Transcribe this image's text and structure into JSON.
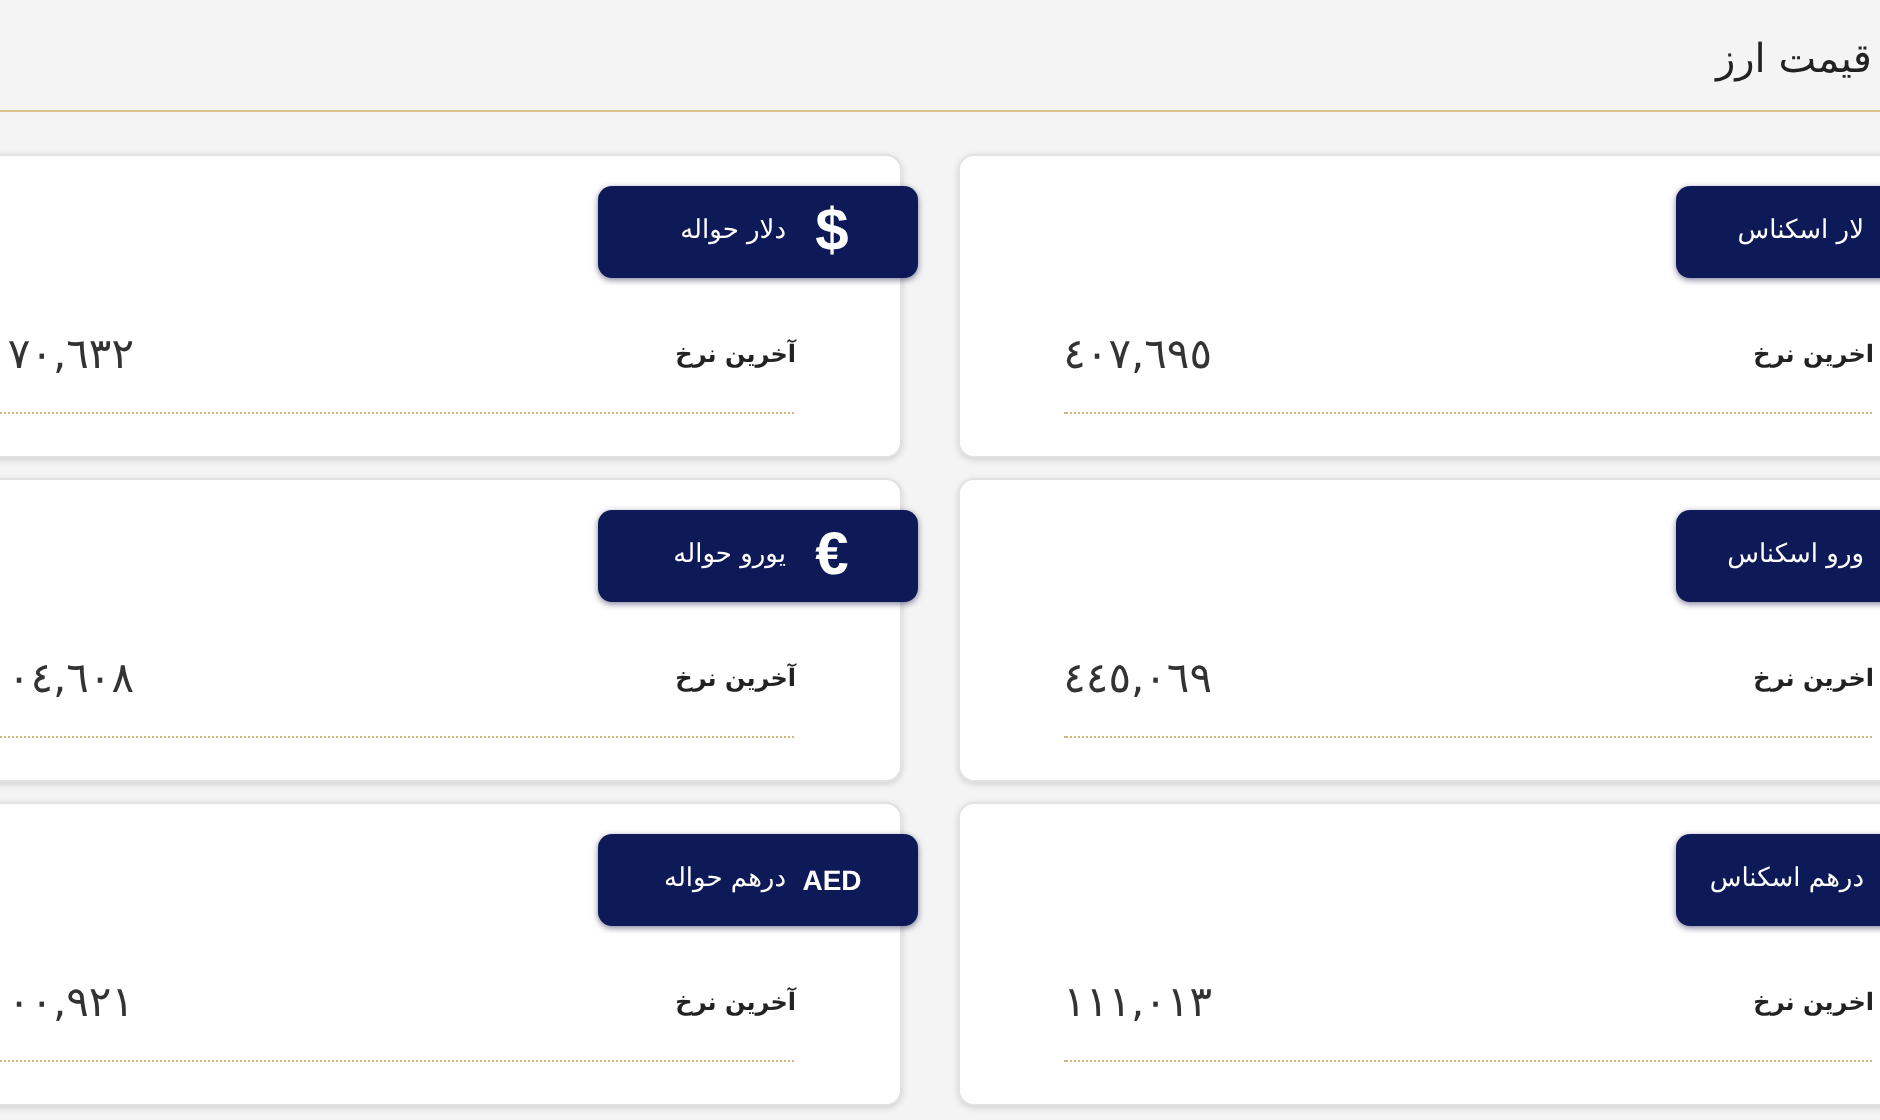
{
  "page": {
    "title": "قیمت ارز"
  },
  "cards": [
    {
      "name": "لار اسکناس",
      "label": "اخرین نرخ",
      "value": "٤٠٧,٦٩٥"
    },
    {
      "name": "دلار حواله",
      "symbol": "$",
      "label": "آخرین نرخ",
      "value": "٧٠,٦٣٢"
    },
    {
      "name": "ورو اسکناس",
      "label": "اخرین نرخ",
      "value": "٤٤٥,٠٦٩"
    },
    {
      "name": "یورو حواله",
      "symbol": "€",
      "label": "آخرین نرخ",
      "value": "٠٤,٦٠٨"
    },
    {
      "name": "درهم اسکناس",
      "label": "اخرین نرخ",
      "value": "١١١,٠١٣"
    },
    {
      "name": "درهم حواله",
      "symbol": "AED",
      "label": "آخرین نرخ",
      "value": "٠٠,٩٢١"
    }
  ]
}
